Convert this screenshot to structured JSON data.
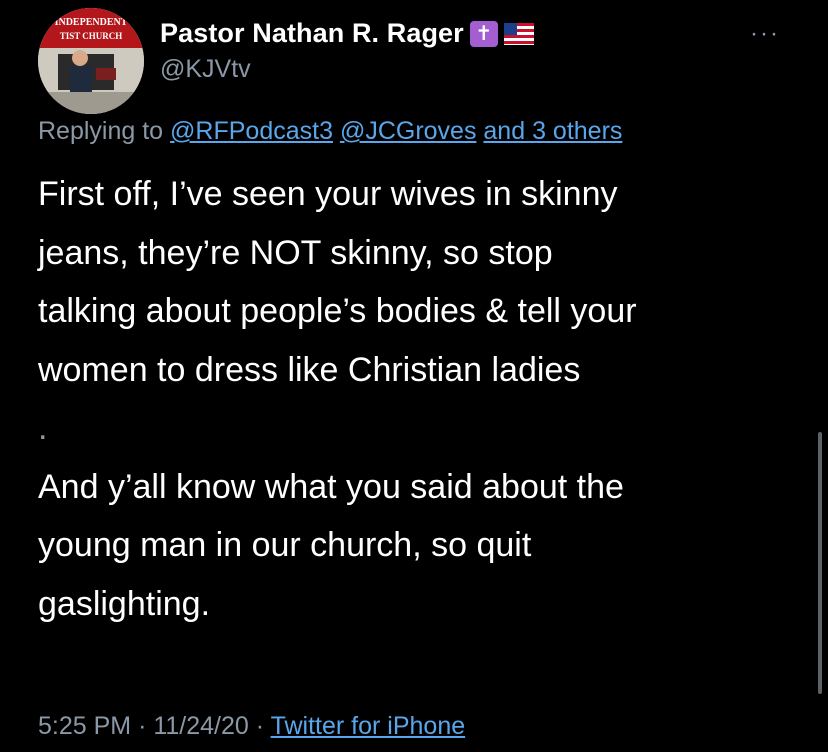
{
  "author": {
    "display_name": "Pastor Nathan R. Rager",
    "handle": "@KJVtv",
    "badges": [
      "cross-emoji",
      "us-flag-emoji"
    ],
    "avatar_sign_text": [
      "INDEPENDENT",
      "TIST CHURCH"
    ]
  },
  "more_label": "···",
  "reply": {
    "prefix": "Replying to",
    "mention_1": "@RFPodcast3",
    "mention_2": "@JCGroves",
    "others": "and 3 others"
  },
  "tweet": {
    "lines": [
      "First off, I’ve seen your wives in skinny",
      "jeans, they’re NOT skinny, so stop",
      "talking about people’s bodies & tell your",
      "women to dress like Christian ladies",
      ".",
      "And y’all know what you said about the",
      "young man in our church, so quit",
      "gaslighting."
    ]
  },
  "meta": {
    "time": "5:25 PM",
    "separator": "·",
    "date": "11/24/20",
    "source": "Twitter for iPhone"
  },
  "colors": {
    "background": "#000000",
    "text": "#ffffff",
    "secondary": "#8b98a5",
    "link": "#5aa6ea",
    "cross_badge": "#a35fd1"
  }
}
